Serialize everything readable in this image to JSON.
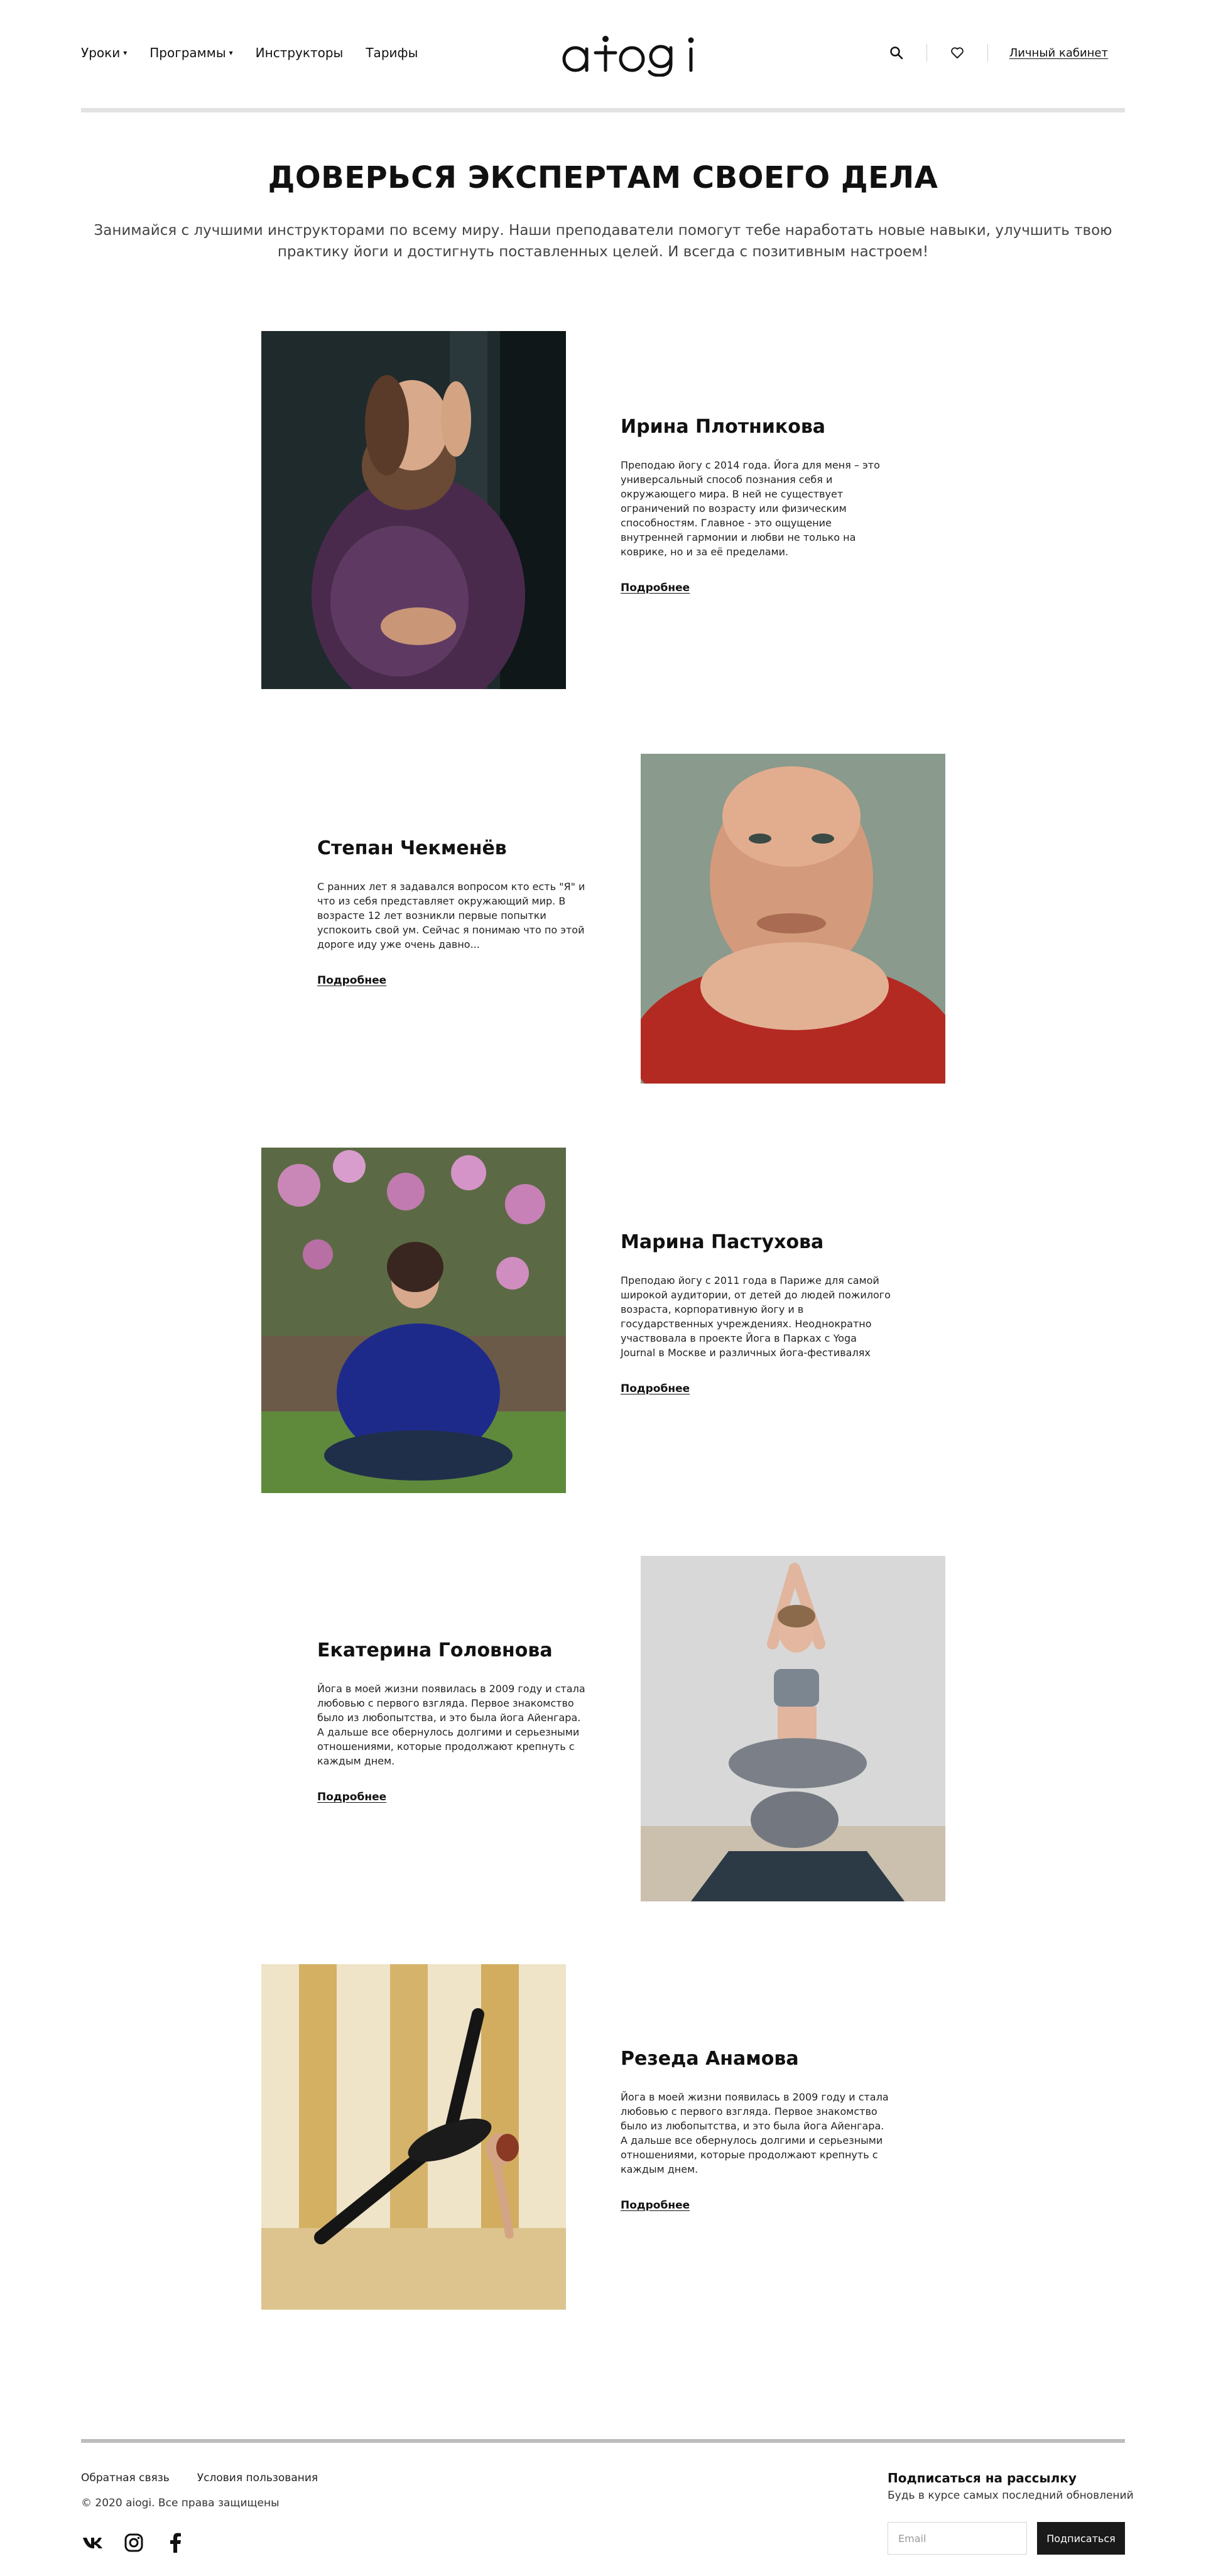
{
  "header": {
    "nav": [
      {
        "label": "Уроки",
        "has_dropdown": true
      },
      {
        "label": "Программы",
        "has_dropdown": true
      },
      {
        "label": "Инструкторы",
        "has_dropdown": false
      },
      {
        "label": "Тарифы",
        "has_dropdown": false
      }
    ],
    "logo_text": "aiogi",
    "search_icon": "search-icon",
    "favorites_icon": "heart-icon",
    "account_label": "Личный кабинет"
  },
  "hero": {
    "title": "ДОВЕРЬСЯ ЭКСПЕРТАМ СВОЕГО ДЕЛА",
    "subtitle": "Занимайся с лучшими инструкторами по всему миру. Наши преподаватели помогут тебе наработать новые навыки, улучшить твою практику йоги и достигнуть поставленных целей. И всегда с позитивным настроем!"
  },
  "instructors": [
    {
      "name": "Ирина Плотникова",
      "bio": "Преподаю йогу с 2014 года. Йога для меня – это универсальный способ познания себя и окружающего мира. В ней не существует ограничений по возрасту или физическим способностям. Главное - это ощущение внутренней гармонии и любви не только на коврике, но и за её пределами.",
      "link": "Подробнее",
      "photo_side": "left"
    },
    {
      "name": "Степан Чекменёв",
      "bio": "С ранних лет я задавался вопросом кто есть \"Я\" и что из себя представляет окружающий мир. В возрасте 12 лет возникли первые попытки успокоить свой ум. Сейчас я понимаю что по этой дороге иду уже очень давно...",
      "link": "Подробнее",
      "photo_side": "right"
    },
    {
      "name": "Марина Пастухова",
      "bio": "Преподаю йогу с 2011 года в Париже для самой широкой аудитории, от детей до людей пожилого возраста, корпоративную йогу и в государственных учреждениях. Неоднократно участвовала в проекте Йога в Парках с Yoga Journal в Москве и различных йога-фестивалях",
      "link": "Подробнее",
      "photo_side": "left"
    },
    {
      "name": "Екатерина Головнова",
      "bio": "Йога в моей жизни появилась в 2009 году и стала любовью с первого взгляда. Первое знакомство было из любопытства, и это была йога Айенгара. А дальше все обернулось долгими и серьезными отношениями, которые продолжают крепнуть с каждым днем.",
      "link": "Подробнее",
      "photo_side": "right"
    },
    {
      "name": "Резеда Анамова",
      "bio": "Йога в моей жизни появилась в 2009 году и стала любовью с первого взгляда. Первое знакомство было из любопытства, и это была йога Айенгара. А дальше все обернулось долгими и серьезными отношениями, которые продолжают крепнуть с каждым днем.",
      "link": "Подробнее",
      "photo_side": "left"
    }
  ],
  "footer": {
    "links": [
      "Обратная связь",
      "Условия пользования"
    ],
    "copyright": "© 2020 aiogi. Все права защищены",
    "socials": [
      "vk-icon",
      "instagram-icon",
      "facebook-icon"
    ],
    "newsletter": {
      "title": "Подписаться на рассылку",
      "subtitle": "Будь в курсе самых последний обновлений",
      "email_placeholder": "Email",
      "button_label": "Подписаться"
    }
  },
  "colors": {
    "text": "#111111",
    "button_bg": "#1a1a1a",
    "divider": "#e2e2e2"
  }
}
